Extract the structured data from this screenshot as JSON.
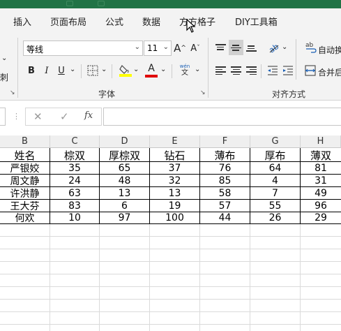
{
  "menu": {
    "tabs": [
      "插入",
      "页面布局",
      "公式",
      "数据",
      "方方格子",
      "DIY工具箱"
    ]
  },
  "ribbon": {
    "font_name": "等线",
    "font_size": "11",
    "increase_font": "A^",
    "decrease_font": "A˅",
    "bold": "B",
    "italic": "I",
    "underline": "U",
    "phonetic_top": "wén",
    "phonetic_bottom": "文",
    "font_group_label": "字体",
    "align_group_label": "对齐方式",
    "wrap_text": "自动换",
    "merge_center": "合并后",
    "left_cut": "刺",
    "font_color": "#e00000",
    "fill_color": "#ffff00"
  },
  "formula_bar": {
    "cancel": "✕",
    "enter": "✓",
    "fx": "fx",
    "value": ""
  },
  "sheet": {
    "columns": [
      "B",
      "C",
      "D",
      "E",
      "F",
      "G",
      "H"
    ],
    "header_row": [
      "姓名",
      "棕双",
      "厚棕双",
      "钻石",
      "薄布",
      "厚布",
      "薄双"
    ],
    "rows": [
      [
        "严银姣",
        "35",
        "65",
        "37",
        "76",
        "64",
        "81"
      ],
      [
        "周文静",
        "24",
        "48",
        "32",
        "85",
        "4",
        "31"
      ],
      [
        "许洪静",
        "63",
        "13",
        "13",
        "58",
        "7",
        "49"
      ],
      [
        "王大芬",
        "83",
        "6",
        "19",
        "57",
        "55",
        "96"
      ],
      [
        "何欢",
        "10",
        "97",
        "100",
        "44",
        "26",
        "29"
      ]
    ]
  }
}
